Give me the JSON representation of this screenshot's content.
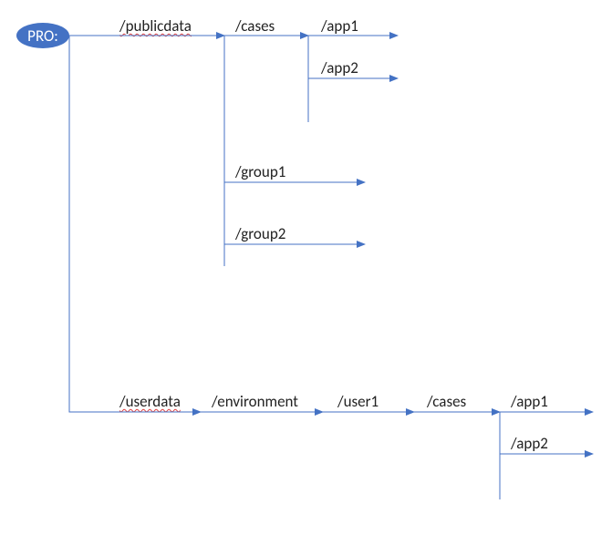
{
  "root": {
    "label": "PRO:"
  },
  "nodes": {
    "publicdata": "/publicdata",
    "cases1": "/cases",
    "app1_top": "/app1",
    "app2_top": "/app2",
    "group1": "/group1",
    "group2": "/group2",
    "userdata": "/userdata",
    "environment": "/environment",
    "user1": "/user1",
    "cases2": "/cases",
    "app1_bot": "/app1",
    "app2_bot": "/app2"
  }
}
